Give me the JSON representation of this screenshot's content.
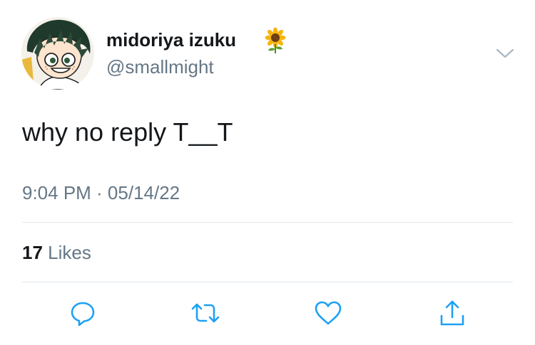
{
  "author": {
    "display_name": "midoriya izuku",
    "handle": "@smallmight",
    "name_emoji": "sunflower-icon"
  },
  "tweet": {
    "text": "why no reply T__T",
    "timestamp": "9:04 PM · 05/14/22"
  },
  "stats": {
    "likes_count": "17",
    "likes_label": "Likes"
  },
  "actions": {
    "reply": "reply-icon",
    "retweet": "retweet-icon",
    "like": "heart-icon",
    "share": "share-icon"
  },
  "colors": {
    "text_primary": "#14171a",
    "text_secondary": "#657786",
    "icon": "#1da1f2",
    "divider": "#e1e8ed"
  }
}
